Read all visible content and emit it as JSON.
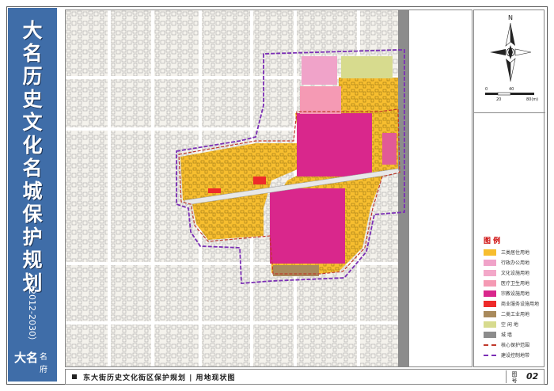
{
  "banner": {
    "title_chars": [
      "大",
      "名",
      "历",
      "史",
      "文",
      "化",
      "名",
      "城",
      "保",
      "护",
      "规",
      "划"
    ],
    "years": "（2012-2030）",
    "logo_big": "大名",
    "logo_small_1": "名",
    "logo_small_2": "府"
  },
  "compass": {
    "north": "N",
    "scale": [
      "0",
      "20",
      "40",
      "80(m)"
    ]
  },
  "legend": {
    "title": "图 例",
    "items": [
      {
        "label": "三类居住用地",
        "color": "#f7be2f",
        "kind": "fill"
      },
      {
        "label": "行政办公用地",
        "color": "#f0a3c9",
        "kind": "fill"
      },
      {
        "label": "文化设施用地",
        "color": "#f3a8c9",
        "kind": "fill"
      },
      {
        "label": "医疗卫生用地",
        "color": "#f59ab4",
        "kind": "fill"
      },
      {
        "label": "宗教设施用地",
        "color": "#d9278c",
        "kind": "fill"
      },
      {
        "label": "商业服务设施用地",
        "color": "#ee2a2a",
        "kind": "fill"
      },
      {
        "label": "二类工业用地",
        "color": "#a98a5c",
        "kind": "fill"
      },
      {
        "label": "空 闲 地",
        "color": "#d7db8e",
        "kind": "fill"
      },
      {
        "label": "城 墙",
        "color": "#8c8c8c",
        "kind": "fill"
      },
      {
        "label": "核心保护范围",
        "color": "#c0392b",
        "kind": "dash"
      },
      {
        "label": "建设控制地带",
        "color": "#7b2fb5",
        "kind": "dash"
      }
    ]
  },
  "footer": {
    "caption": "东大街历史文化街区保护规划 | 用地现状图",
    "tu_label": "图号",
    "number": "02"
  }
}
